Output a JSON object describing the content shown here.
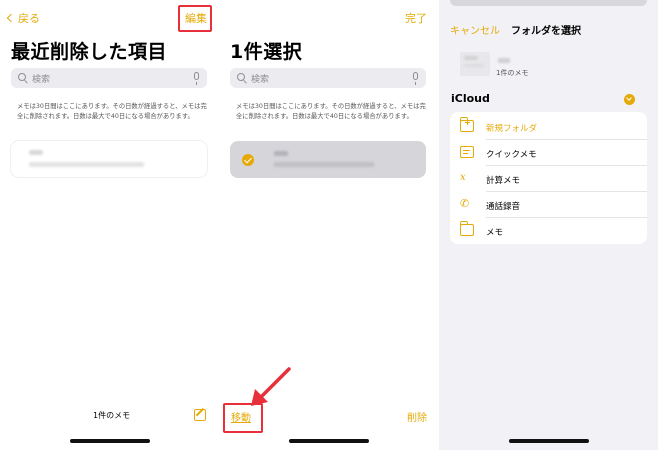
{
  "colors": {
    "accent": "#e5aa07",
    "highlight": "#e8303a"
  },
  "left": {
    "back_label": "戻る",
    "edit_label": "編集",
    "title": "最近削除した項目",
    "search_placeholder": "検索",
    "notice": "メモは30日間はここにあります。その日数が経過すると、メモは完全に削除されます。日数は最大で40日になる場合があります。",
    "count_label": "1件のメモ",
    "compose_icon": "compose-icon"
  },
  "middle": {
    "done_label": "完了",
    "title": "1件選択",
    "search_placeholder": "検索",
    "notice": "メモは30日間はここにあります。その日数が経過すると、メモは完全に削除されます。日数は最大で40日になる場合があります。",
    "move_label": "移動",
    "delete_label": "削除"
  },
  "right": {
    "cancel_label": "キャンセル",
    "title": "フォルダを選択",
    "preview_count": "1件のメモ",
    "section_title": "iCloud",
    "folders": [
      {
        "label": "新規フォルダ",
        "icon": "new-folder-icon"
      },
      {
        "label": "クイックメモ",
        "icon": "quick-note-icon"
      },
      {
        "label": "計算メモ",
        "icon": "math-note-icon"
      },
      {
        "label": "通話録音",
        "icon": "phone-recording-icon"
      },
      {
        "label": "メモ",
        "icon": "folder-icon"
      }
    ]
  }
}
